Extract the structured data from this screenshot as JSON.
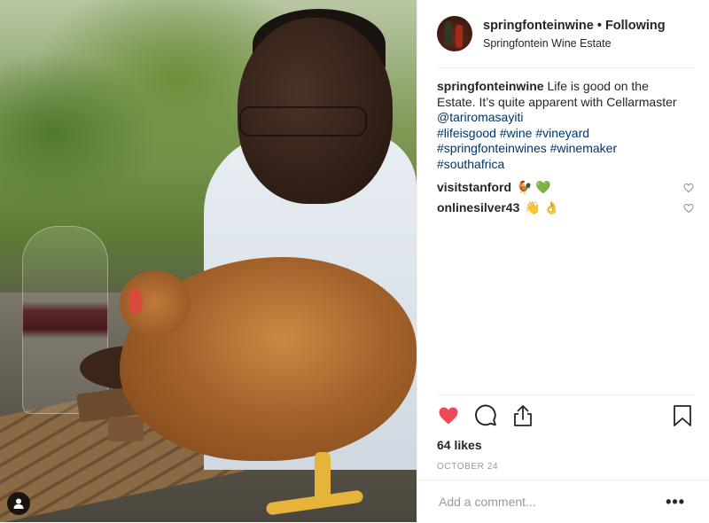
{
  "post": {
    "username": "springfonteinwine",
    "separator": "•",
    "follow_status": "Following",
    "location": "Springfontein Wine Estate",
    "caption": {
      "username": "springfonteinwine",
      "text1": "Life is good on the Estate. It’s quite apparent with Cellarmaster",
      "mention": "@tariromasayiti",
      "hashtags": [
        "#lifeisgood",
        "#wine",
        "#vineyard",
        "#springfonteinwines",
        "#winemaker",
        "#southafrica"
      ]
    },
    "comments": [
      {
        "username": "visitstanford",
        "text": "🐓 💚"
      },
      {
        "username": "onlinesilver43",
        "text": "👋 👌"
      }
    ],
    "likes": "64 likes",
    "date": "OCTOBER 24",
    "comment_placeholder": "Add a comment...",
    "more_label": "•••"
  },
  "icons": {
    "like": "heart-filled-icon",
    "comment": "comment-icon",
    "share": "share-icon",
    "save": "bookmark-icon",
    "tagged": "user-tag-icon",
    "comment_like": "heart-outline-icon"
  },
  "colors": {
    "like_red": "#ed4956",
    "link_blue": "#003569",
    "text": "#262626",
    "muted": "#999999"
  }
}
